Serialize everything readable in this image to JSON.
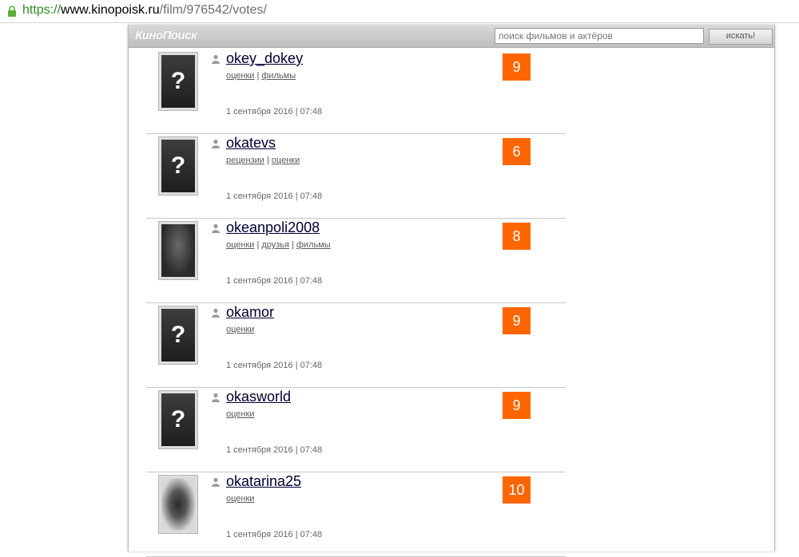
{
  "browser": {
    "url_scheme": "https://",
    "url_host": "www.kinopoisk.ru",
    "url_path": "/film/976542/votes/"
  },
  "site": {
    "logo": "КиноПоиск",
    "search_placeholder": "поиск фильмов и актёров",
    "search_button": "искать!"
  },
  "votes": [
    {
      "user": "okey_dokey",
      "links": [
        "оценки",
        "фильмы"
      ],
      "date": "1 сентября 2016 | 07:48",
      "score": "9",
      "avatar": "placeholder"
    },
    {
      "user": "okatevs",
      "links": [
        "рецензии",
        "оценки"
      ],
      "date": "1 сентября 2016 | 07:48",
      "score": "6",
      "avatar": "placeholder"
    },
    {
      "user": "okeanpoli2008",
      "links": [
        "оценки",
        "друзья",
        "фильмы"
      ],
      "date": "1 сентября 2016 | 07:48",
      "score": "8",
      "avatar": "photo"
    },
    {
      "user": "okamor",
      "links": [
        "оценки"
      ],
      "date": "1 сентября 2016 | 07:48",
      "score": "9",
      "avatar": "placeholder"
    },
    {
      "user": "okasworld",
      "links": [
        "оценки"
      ],
      "date": "1 сентября 2016 | 07:48",
      "score": "9",
      "avatar": "placeholder"
    },
    {
      "user": "okatarina25",
      "links": [
        "оценки"
      ],
      "date": "1 сентября 2016 | 07:48",
      "score": "10",
      "avatar": "photo"
    }
  ],
  "placeholder_avatar_glyph": "?",
  "colors": {
    "score_bg": "#ff6600",
    "url_scheme": "#2d8b24"
  }
}
